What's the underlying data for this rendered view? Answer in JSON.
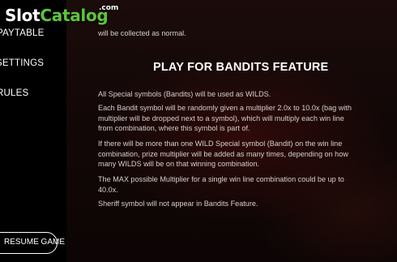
{
  "logo": {
    "slot": "Slot",
    "catalog": "Catalog",
    "com": ".com"
  },
  "sidebar": {
    "items": [
      {
        "label": "PAYTABLE"
      },
      {
        "label": "SETTINGS"
      },
      {
        "label": "RULES"
      }
    ],
    "resume_label": "RESUME GAME"
  },
  "content": {
    "top_line": "will be collected as normal.",
    "heading": "PLAY FOR BANDITS FEATURE",
    "paragraphs": [
      [
        "All Special symbols (Bandits) will be used as WILDS."
      ],
      [
        "Each Bandit symbol will be randomly given a multiplier 2.0x to 10.0x (bag with",
        "multiplier will be dropped next to a symbol), which will multiply each win line",
        "from combination, where this symbol is part of."
      ],
      [
        "If there will be more than one WILD Special symbol (Bandit) on the win line",
        "combination, prize multiplier will be added as many times, depending on how",
        "many WILDS will be on that winning combination."
      ],
      [
        "The MAX possible Multiplier for a single win line combination could be up to",
        "40.0x."
      ],
      [
        "Sheriff symbol will not appear in Bandits Feature."
      ]
    ]
  },
  "colors": {
    "accent": "#5cc43c",
    "sidebar_bg": "#000000",
    "heading": "#ffffff"
  }
}
